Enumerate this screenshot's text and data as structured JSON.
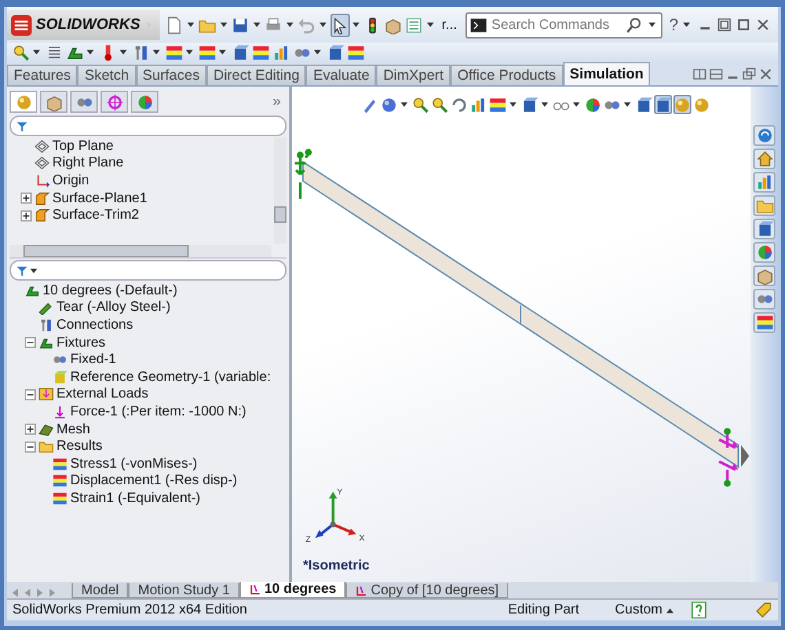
{
  "title_bar": {
    "logo": "SOLIDWORKS",
    "overflow": "r...",
    "search": {
      "placeholder": "Search Commands"
    },
    "help": "?"
  },
  "command_tabs": [
    {
      "label": "Features",
      "selected": false
    },
    {
      "label": "Sketch",
      "selected": false
    },
    {
      "label": "Surfaces",
      "selected": false
    },
    {
      "label": "Direct Editing",
      "selected": false
    },
    {
      "label": "Evaluate",
      "selected": false
    },
    {
      "label": "DimXpert",
      "selected": false
    },
    {
      "label": "Office Products",
      "selected": false
    },
    {
      "label": "Simulation",
      "selected": true
    }
  ],
  "panel_tabs": {
    "tabs": [
      {
        "selected": true
      },
      {
        "selected": false
      },
      {
        "selected": false
      },
      {
        "selected": false
      },
      {
        "selected": false
      }
    ],
    "more": "»"
  },
  "feature_tree": [
    {
      "label": "Top Plane",
      "kind": "plane"
    },
    {
      "label": "Right Plane",
      "kind": "plane"
    },
    {
      "label": "Origin",
      "kind": "origin"
    },
    {
      "label": "Surface-Plane1",
      "kind": "surface",
      "expanded": false
    },
    {
      "label": "Surface-Trim2",
      "kind": "trim",
      "expanded": false
    }
  ],
  "study_tree": [
    {
      "label": "10 degrees (-Default-)",
      "kind": "study",
      "children": [
        {
          "label": "Tear (-Alloy Steel-)",
          "kind": "material"
        },
        {
          "label": "Connections",
          "kind": "connections"
        },
        {
          "label": "Fixtures",
          "kind": "fixtures",
          "expanded": true,
          "children": [
            {
              "label": "Fixed-1",
              "kind": "fixed"
            },
            {
              "label": "Reference Geometry-1 (variable:",
              "kind": "reference"
            }
          ]
        },
        {
          "label": "External Loads",
          "kind": "loads",
          "expanded": true,
          "children": [
            {
              "label": "Force-1 (:Per item: -1000 N:)",
              "kind": "force"
            }
          ]
        },
        {
          "label": "Mesh",
          "kind": "mesh",
          "expanded": false
        },
        {
          "label": "Results",
          "kind": "results",
          "expanded": true,
          "children": [
            {
              "label": "Stress1 (-vonMises-)",
              "kind": "plot"
            },
            {
              "label": "Displacement1 (-Res disp-)",
              "kind": "plot"
            },
            {
              "label": "Strain1 (-Equivalent-)",
              "kind": "plot"
            }
          ]
        }
      ]
    }
  ],
  "viewport": {
    "view_label": "*Isometric",
    "axes": [
      "X",
      "Y",
      "Z"
    ]
  },
  "bottom_tabs": [
    {
      "label": "Model",
      "selected": false,
      "kind": "plain"
    },
    {
      "label": "Motion Study 1",
      "selected": false,
      "kind": "plain"
    },
    {
      "label": "10 degrees",
      "selected": true,
      "kind": "study"
    },
    {
      "label": "Copy of [10 degrees]",
      "selected": false,
      "kind": "study"
    }
  ],
  "status_bar": {
    "edition": "SolidWorks Premium 2012 x64 Edition",
    "mode": "Editing Part",
    "units": "Custom"
  }
}
